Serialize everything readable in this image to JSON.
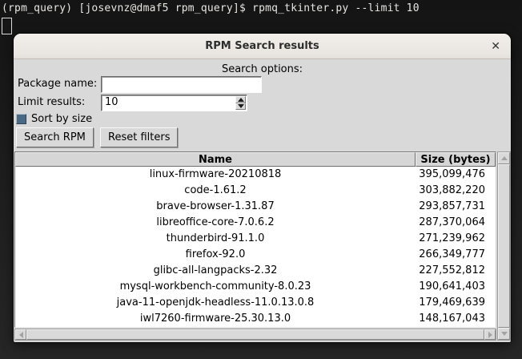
{
  "terminal": {
    "prompt_line": "(rpm_query) [josevnz@dmaf5 rpm_query]$ rpmq_tkinter.py --limit 10"
  },
  "window": {
    "title": "RPM Search results",
    "close_glyph": "✕",
    "search_options_label": "Search options:",
    "form": {
      "package_label": "Package name:",
      "package_value": "",
      "limit_label": "Limit results:",
      "limit_value": "10",
      "sort_checkbox_label": "Sort by size",
      "sort_checkbox_checked": true
    },
    "buttons": {
      "search_label": "Search RPM",
      "reset_label": "Reset filters"
    },
    "table": {
      "columns": [
        "Name",
        "Size (bytes)"
      ],
      "rows": [
        {
          "name": "linux-firmware-20210818",
          "size": "395,099,476"
        },
        {
          "name": "code-1.61.2",
          "size": "303,882,220"
        },
        {
          "name": "brave-browser-1.31.87",
          "size": "293,857,731"
        },
        {
          "name": "libreoffice-core-7.0.6.2",
          "size": "287,370,064"
        },
        {
          "name": "thunderbird-91.1.0",
          "size": "271,239,962"
        },
        {
          "name": "firefox-92.0",
          "size": "266,349,777"
        },
        {
          "name": "glibc-all-langpacks-2.32",
          "size": "227,552,812"
        },
        {
          "name": "mysql-workbench-community-8.0.23",
          "size": "190,641,403"
        },
        {
          "name": "java-11-openjdk-headless-11.0.13.0.8",
          "size": "179,469,639"
        },
        {
          "name": "iwl7260-firmware-25.30.13.0",
          "size": "148,167,043"
        }
      ]
    },
    "colors": {
      "checkbox_accent": "#4a6984",
      "titlebar_bg": "#ece8e3",
      "content_bg": "#d9d9d9",
      "terminal_bg": "#1d1d1d"
    }
  }
}
